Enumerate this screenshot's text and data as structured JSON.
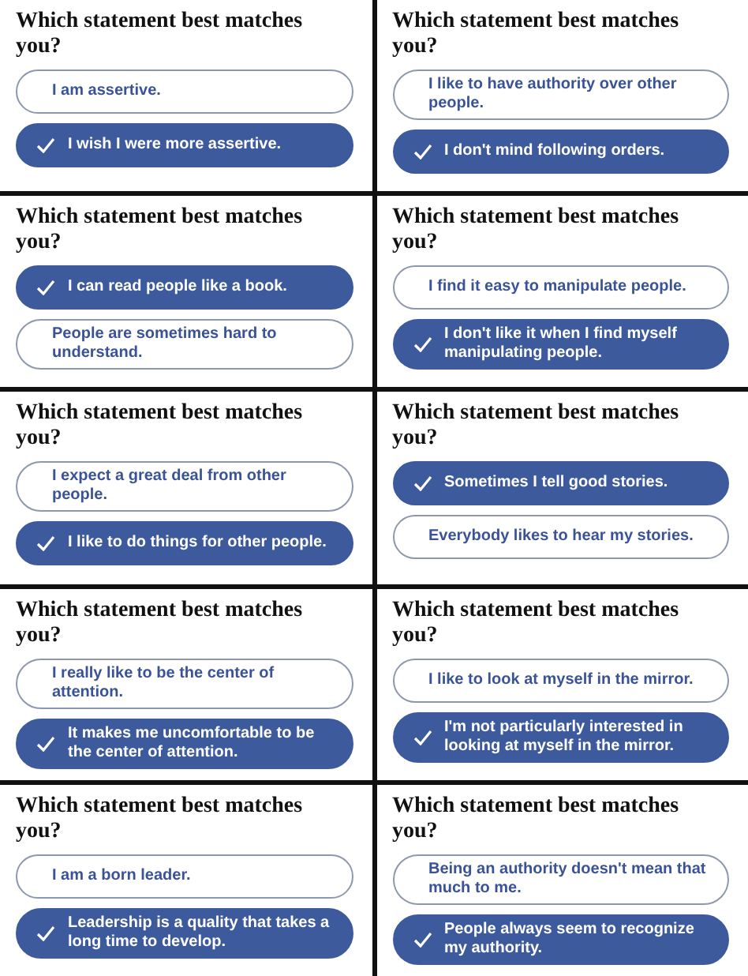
{
  "left_column": [
    {
      "title": "Which statement best matches you?",
      "options": [
        {
          "label": "I am assertive.",
          "selected": false
        },
        {
          "label": "I wish I were more assertive.",
          "selected": true
        }
      ]
    },
    {
      "title": "Which statement best matches you?",
      "options": [
        {
          "label": "I can read people like a book.",
          "selected": true
        },
        {
          "label": "People are sometimes hard to understand.",
          "selected": false
        }
      ]
    },
    {
      "title": "Which statement best matches you?",
      "options": [
        {
          "label": "I expect a great deal from other people.",
          "selected": false
        },
        {
          "label": "I like to do things for other people.",
          "selected": true
        }
      ]
    },
    {
      "title": "Which statement best matches you?",
      "options": [
        {
          "label": "I really like to be the center of attention.",
          "selected": false
        },
        {
          "label": "It makes me uncomfortable to be the center of attention.",
          "selected": true
        }
      ]
    },
    {
      "title": "Which statement best matches you?",
      "options": [
        {
          "label": "I am a born leader.",
          "selected": false
        },
        {
          "label": "Leadership is a quality that takes a long time to develop.",
          "selected": true
        }
      ]
    }
  ],
  "right_column": [
    {
      "title": "Which statement best matches you?",
      "options": [
        {
          "label": "I like to have authority over other people.",
          "selected": false
        },
        {
          "label": "I don't mind following orders.",
          "selected": true
        }
      ]
    },
    {
      "title": "Which statement best matches you?",
      "options": [
        {
          "label": "I find it easy to manipulate people.",
          "selected": false
        },
        {
          "label": "I don't like it when I find myself manipulating people.",
          "selected": true
        }
      ]
    },
    {
      "title": "Which statement best matches you?",
      "options": [
        {
          "label": "Sometimes I tell good stories.",
          "selected": true
        },
        {
          "label": "Everybody likes to hear my stories.",
          "selected": false
        }
      ]
    },
    {
      "title": "Which statement best matches you?",
      "options": [
        {
          "label": "I like to look at myself in the mirror.",
          "selected": false
        },
        {
          "label": "I'm not particularly interested in looking at myself in the mirror.",
          "selected": true
        }
      ]
    },
    {
      "title": "Which statement best matches you?",
      "options": [
        {
          "label": "Being an authority doesn't mean that much to me.",
          "selected": false
        },
        {
          "label": "People always seem to recognize my authority.",
          "selected": true
        }
      ]
    }
  ]
}
